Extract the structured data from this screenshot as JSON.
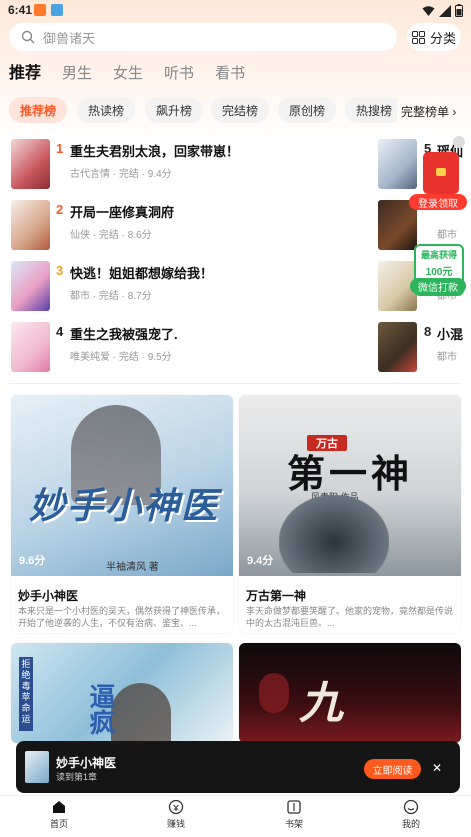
{
  "status": {
    "time": "6:41"
  },
  "search": {
    "placeholder": "御兽诸天"
  },
  "category_btn": "分类",
  "tabs": [
    "推荐",
    "男生",
    "女生",
    "听书",
    "看书"
  ],
  "rank_chips": [
    "推荐榜",
    "热读榜",
    "飙升榜",
    "完结榜",
    "原创榜",
    "热搜榜"
  ],
  "full_rank": "完整榜单 ›",
  "rank_left": [
    {
      "no": "1",
      "title": "重生夫君别太浪，回家带崽！",
      "meta": "古代言情 · 完结 · 9.4分"
    },
    {
      "no": "2",
      "title": "开局一座修真洞府",
      "meta": "仙侠 · 完结 · 8.6分"
    },
    {
      "no": "3",
      "title": "快逃！姐姐都想嫁给我！",
      "meta": "都市 · 完结 · 8.7分"
    },
    {
      "no": "4",
      "title": "重生之我被强宠了.",
      "meta": "唯美纯爱 · 完结 · 9.5分"
    }
  ],
  "rank_right": [
    {
      "no": "5",
      "title": "瑶仙",
      "meta": ""
    },
    {
      "no": "6",
      "title": "",
      "meta": "都市"
    },
    {
      "no": "7",
      "title": "",
      "meta": "都市"
    },
    {
      "no": "8",
      "title": "小混",
      "meta": "都市"
    }
  ],
  "floats": {
    "redbag_label": "登录领取",
    "wx_top": "最高获得",
    "wx_amount": "100元",
    "wx_label": "微信打款"
  },
  "cards": [
    {
      "score": "9.6分",
      "title": "妙手小神医",
      "desc": "本来只是一个小村医的吴天，偶然获得了神医传承，开始了他逆袭的人生，不仅有治病、鉴宝、...",
      "cover_text": "妙手小神医",
      "cover_author": "半袖清风 著"
    },
    {
      "score": "9.4分",
      "title": "万古第一神",
      "desc": "李天命做梦都要笑醒了。他家的宠物，竟然都是传说中的太古混沌巨兽。...",
      "cover_text": "第一神",
      "cover_badge": "万古",
      "cover_author": "风青阳 作品"
    },
    {
      "score": "",
      "title": "",
      "desc": "",
      "cover_text": "逼疯",
      "cover_side": "拒绝毒苹命运"
    },
    {
      "score": "",
      "title": "",
      "desc": "",
      "cover_text": "九"
    }
  ],
  "now_reading": {
    "title": "妙手小神医",
    "progress": "读到第1章",
    "button": "立即阅读"
  },
  "nav": [
    "首页",
    "赚钱",
    "书架",
    "我的"
  ],
  "colors": {
    "accent": "#ff5a2c",
    "gold": "#f0a020",
    "wx_green": "#2db55d"
  }
}
